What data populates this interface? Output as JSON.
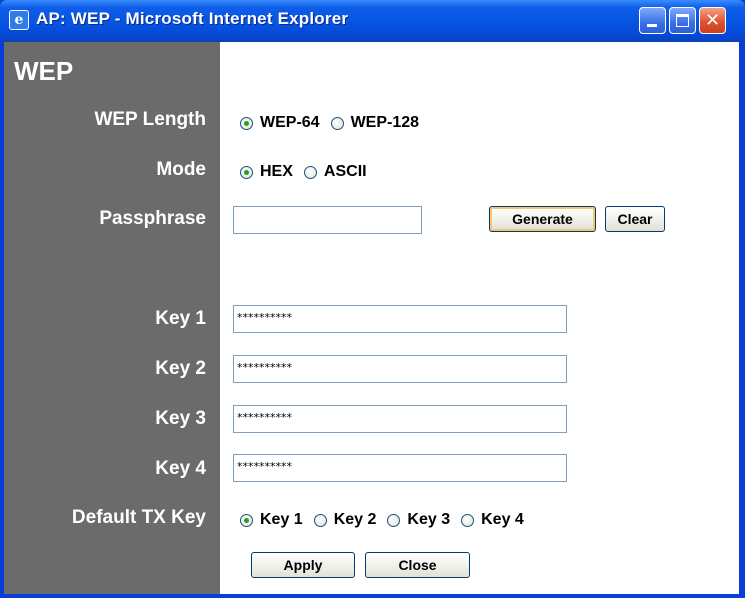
{
  "window": {
    "title": "AP: WEP - Microsoft Internet Explorer",
    "app_icon": "ie-icon"
  },
  "page": {
    "title": "WEP"
  },
  "wep_length": {
    "label": "WEP Length",
    "options": [
      "WEP-64",
      "WEP-128"
    ],
    "selected": "WEP-64"
  },
  "mode": {
    "label": "Mode",
    "options": [
      "HEX",
      "ASCII"
    ],
    "selected": "HEX"
  },
  "passphrase": {
    "label": "Passphrase",
    "value": "",
    "generate_label": "Generate",
    "clear_label": "Clear"
  },
  "keys": [
    {
      "label": "Key 1",
      "value": "**********"
    },
    {
      "label": "Key 2",
      "value": "**********"
    },
    {
      "label": "Key 3",
      "value": "**********"
    },
    {
      "label": "Key 4",
      "value": "**********"
    }
  ],
  "default_tx_key": {
    "label": "Default TX Key",
    "options": [
      "Key 1",
      "Key 2",
      "Key 3",
      "Key 4"
    ],
    "selected": "Key 1"
  },
  "actions": {
    "apply_label": "Apply",
    "close_label": "Close"
  },
  "colors": {
    "sidebar": "#6b6b6b",
    "titlebar": "#0654e3",
    "radio_dot": "#21a121",
    "default_button_glow": "#f6c66b"
  }
}
